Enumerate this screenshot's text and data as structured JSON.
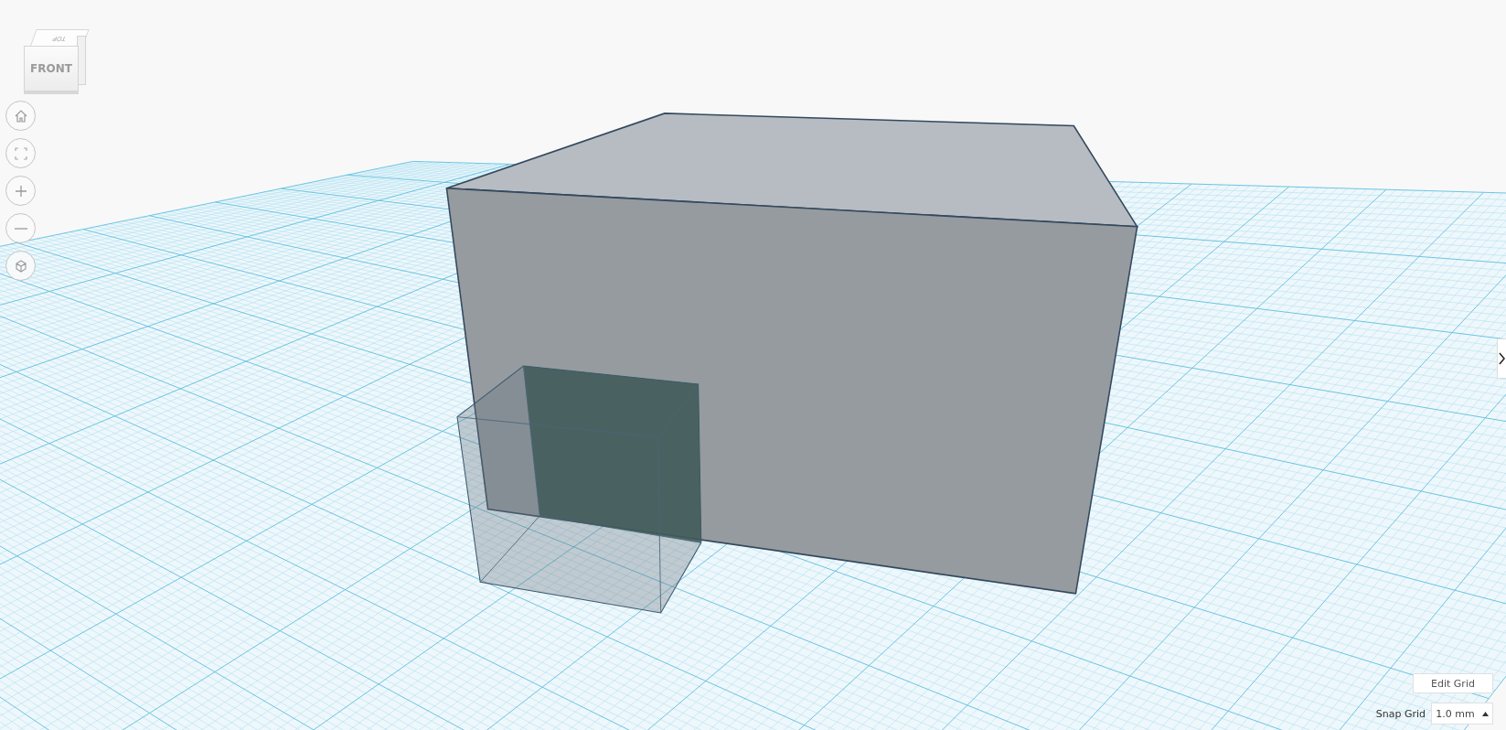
{
  "view_cube": {
    "top": "TOP",
    "front": "FRONT"
  },
  "grid_controls": {
    "edit_button": "Edit Grid",
    "snap_label": "Snap Grid",
    "snap_value": "1.0 mm"
  }
}
